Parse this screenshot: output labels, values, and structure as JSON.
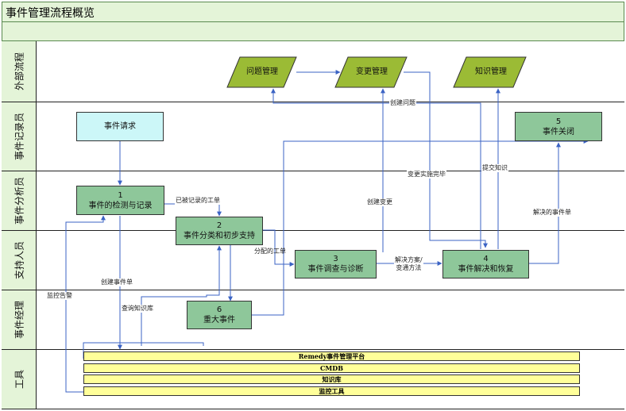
{
  "title": "事件管理流程概览",
  "lanes": [
    "外部流程",
    "事件记录员",
    "事件分析员",
    "支持人员",
    "事件经理",
    "工具"
  ],
  "processes": {
    "problem_mgmt": "问题管理",
    "change_mgmt": "变更管理",
    "knowledge_mgmt": "知识管理"
  },
  "nodes": {
    "request": "事件请求",
    "n1_num": "1",
    "n1_text": "事件的检测与记录",
    "n2_num": "2",
    "n2_text": "事件分类和初步支持",
    "n3_num": "3",
    "n3_text": "事件调查与诊断",
    "n4_num": "4",
    "n4_text": "事件解决和恢复",
    "n5_num": "5",
    "n5_text": "事件关闭",
    "n6_num": "6",
    "n6_text": "重大事件"
  },
  "tools": [
    "Remedy事件管理平台",
    "CMDB",
    "知识库",
    "监控工具"
  ],
  "edge_labels": {
    "recorded_ticket": "已被记录的工单",
    "assigned_ticket": "分配的工单",
    "solution_workaround": "解决方案/\n变通方法",
    "resolved_ticket": "解决的事件单",
    "create_problem": "创建问题",
    "change_done": "变更实施完毕",
    "submit_knowledge": "提交知识",
    "create_change": "创建变更",
    "create_ticket": "创建事件单",
    "monitor_alert": "监控告警",
    "query_kb": "查询知识库"
  }
}
